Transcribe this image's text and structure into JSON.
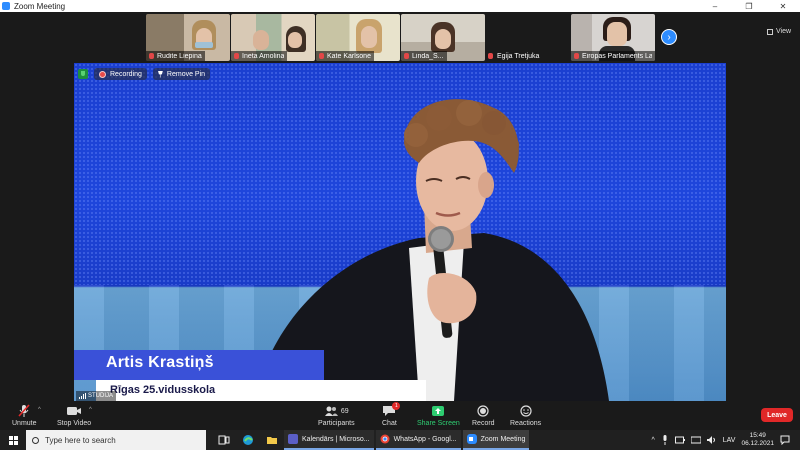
{
  "window": {
    "title": "Zoom Meeting",
    "minimize": "–",
    "restore": "❐",
    "close": "✕"
  },
  "participants": [
    {
      "name": "Rudite Liepina"
    },
    {
      "name": "Ineta Amolina"
    },
    {
      "name": "Kate Karlsone"
    },
    {
      "name": "Linda_S..."
    },
    {
      "name": "Egija Tretjuka"
    },
    {
      "name": "Eiropas Parlaments Lat..."
    }
  ],
  "strip": {
    "next": "›",
    "view_label": "View"
  },
  "topbar": {
    "recording_label": "Recording",
    "remove_pin_label": "Remove Pin"
  },
  "video": {
    "speaker_name": "Artis Krastiņš",
    "speaker_subtitle": "Rīgas 25.vidusskola",
    "studio_label": "STUDIJA"
  },
  "toolbar": {
    "unmute": "Unmute",
    "stop_video": "Stop Video",
    "participants": "Participants",
    "participants_count": "69",
    "chat": "Chat",
    "chat_badge": "1",
    "share_screen": "Share Screen",
    "record": "Record",
    "reactions": "Reactions",
    "leave": "Leave"
  },
  "taskbar": {
    "search_placeholder": "Type here to search",
    "apps": [
      {
        "label": "Kalendārs | Microso..."
      },
      {
        "label": "WhatsApp - Googl..."
      },
      {
        "label": "Zoom Meeting"
      }
    ],
    "language": "LAV",
    "time": "15:49",
    "date": "06.12.2021"
  },
  "colors": {
    "accent": "#2d8cff",
    "leave": "#e02828",
    "share": "#2ecc71",
    "stage_blue": "#1e46dc"
  }
}
